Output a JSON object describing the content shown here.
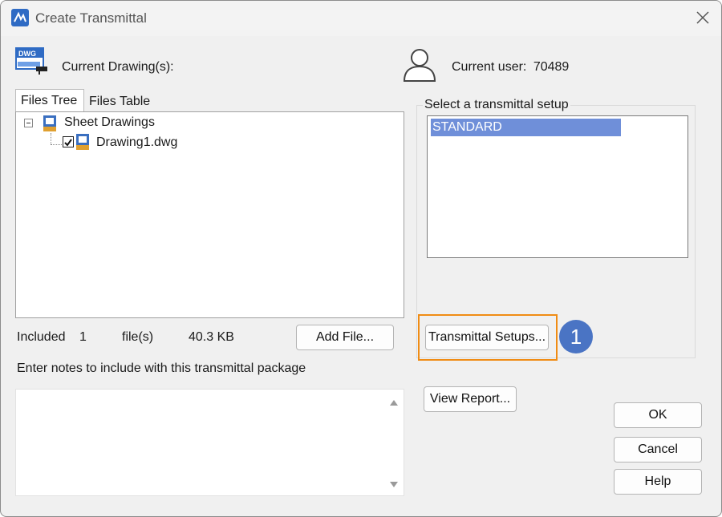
{
  "window": {
    "title": "Create Transmittal"
  },
  "drawings": {
    "label": "Current Drawing(s):",
    "tabs": [
      {
        "label": "Files Tree",
        "active": true
      },
      {
        "label": "Files Table",
        "active": false
      }
    ],
    "tree": {
      "root": "Sheet Drawings",
      "children": [
        {
          "label": "Drawing1.dwg",
          "checked": true
        }
      ]
    },
    "summary": {
      "included_label": "Included",
      "count": "1",
      "unit": "file(s)",
      "size": "40.3 KB"
    },
    "add_file_label": "Add File..."
  },
  "user": {
    "label": "Current user:",
    "value": "70489"
  },
  "setup": {
    "label": "Select a transmittal setup",
    "items": [
      "STANDARD"
    ],
    "selected": "STANDARD",
    "transmittal_setups_label": "Transmittal Setups...",
    "callout_number": "1"
  },
  "notes": {
    "label": "Enter notes to include with this transmittal package",
    "value": ""
  },
  "buttons": {
    "view_report": "View Report...",
    "ok": "OK",
    "cancel": "Cancel",
    "help": "Help"
  },
  "colors": {
    "selection": "#6f8fd9",
    "callout": "#4a74c4",
    "highlight_border": "#f08c14"
  },
  "icons": {
    "app": "app-icon",
    "close": "close-icon",
    "drawing": "dwg-icon",
    "user": "user-icon"
  }
}
